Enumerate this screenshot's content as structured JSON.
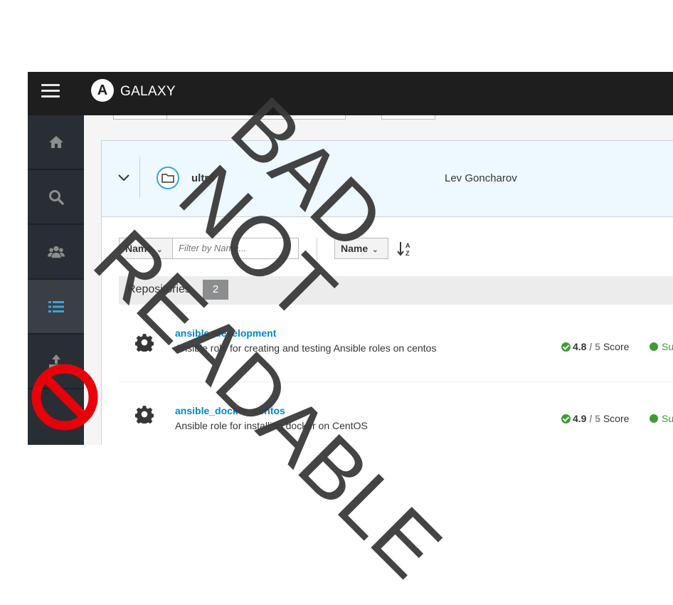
{
  "header": {
    "brand": "GALAXY",
    "logo_letter": "A"
  },
  "sidebar": {
    "items": [
      {
        "icon": "home-icon"
      },
      {
        "icon": "search-icon"
      },
      {
        "icon": "users-icon"
      },
      {
        "icon": "list-icon",
        "active": true
      },
      {
        "icon": "upload-icon"
      }
    ]
  },
  "namespace": {
    "name": "ultr4",
    "owner": "Lev Goncharov"
  },
  "toolbar": {
    "filter_field": "Name",
    "filter_placeholder": "Filter by Name...",
    "sort_field": "Name"
  },
  "repositories": {
    "label": "Repositories",
    "count": "2",
    "items": [
      {
        "name": "ansible_development",
        "description": "Ansible role for creating and testing Ansible roles on centos",
        "score": "4.8",
        "score_max": "/ 5",
        "score_label": "Score",
        "status": "Su"
      },
      {
        "name": "ansible_docker_centos",
        "description": "Ansible role for installing docker on CentOS",
        "score": "4.9",
        "score_max": "/ 5",
        "score_label": "Score",
        "status": "Su"
      }
    ]
  },
  "watermark": {
    "lines": [
      "BAD",
      "NOT",
      "READABLE"
    ]
  },
  "colors": {
    "topbar": "#1e1e1e",
    "sidebar": "#292e34",
    "accent": "#39a5dc",
    "link": "#0088ce",
    "success": "#3f9c35",
    "watermark_text": "#3a3a3a",
    "no_sign": "#e8000b"
  }
}
